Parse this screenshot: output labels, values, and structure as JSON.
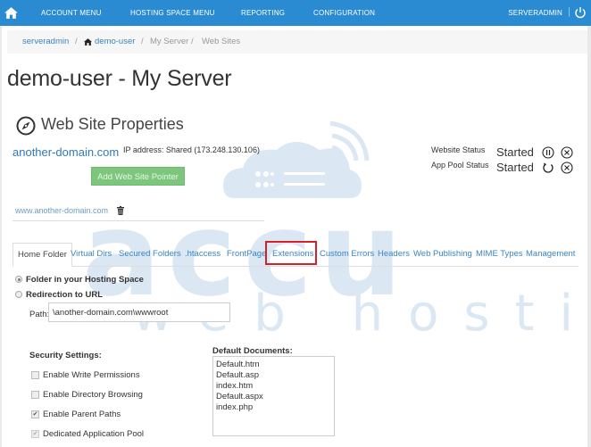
{
  "topbar": {
    "home_icon": "home-icon",
    "nav": [
      "ACCOUNT MENU",
      "HOSTING SPACE MENU",
      "REPORTING",
      "CONFIGURATION"
    ],
    "user": "SERVERADMIN",
    "separator": "|",
    "power_icon": "power-icon"
  },
  "breadcrumb": {
    "items": [
      "serveradmin",
      "demo-user",
      "My Server",
      "Web Sites"
    ],
    "separator": "/"
  },
  "page_title": "demo-user - My Server",
  "section": {
    "icon": "compass-icon",
    "title": "Web Site Properties"
  },
  "site": {
    "domain": "another-domain.com",
    "ip_address": "IP address: Shared (173.248.130.106)",
    "add_pointer_label": "Add Web Site Pointer",
    "pointers": [
      "www.another-domain.com"
    ]
  },
  "status": {
    "website_label": "Website Status",
    "website_value": "Started",
    "apppool_label": "App Pool Status",
    "apppool_value": "Started"
  },
  "tabs": [
    {
      "label": "Home Folder",
      "active": true
    },
    {
      "label": "Virtual Dirs"
    },
    {
      "label": "Secured Folders"
    },
    {
      "label": ".htaccess"
    },
    {
      "label": "FrontPage"
    },
    {
      "label": "Extensions",
      "highlighted": true
    },
    {
      "label": "Custom Errors"
    },
    {
      "label": "Headers"
    },
    {
      "label": "Web Publishing"
    },
    {
      "label": "MIME Types"
    },
    {
      "label": "Management"
    }
  ],
  "home_folder": {
    "option_folder": "Folder in your Hosting Space",
    "option_redirect": "Redirection to URL",
    "selected": "folder",
    "path_label": "Path:",
    "path_value": "\\another-domain.com\\wwwroot"
  },
  "security": {
    "title": "Security Settings:",
    "options": [
      {
        "label": "Enable Write Permissions",
        "checked": false
      },
      {
        "label": "Enable Directory Browsing",
        "checked": false
      },
      {
        "label": "Enable Parent Paths",
        "checked": true
      },
      {
        "label": "Dedicated Application Pool",
        "checked": true,
        "disabled": true
      }
    ]
  },
  "default_documents": {
    "title": "Default Documents:",
    "items": [
      "Default.htm",
      "Default.asp",
      "index.htm",
      "Default.aspx",
      "index.php"
    ]
  },
  "watermark": {
    "brand": "accu",
    "tagline": "web hosting"
  },
  "colors": {
    "topbar": "#2a8bd2",
    "link": "#3a84c4",
    "button_green": "#7dc67e",
    "highlight_red": "#d2232a",
    "watermark": "#dbe8f4"
  }
}
